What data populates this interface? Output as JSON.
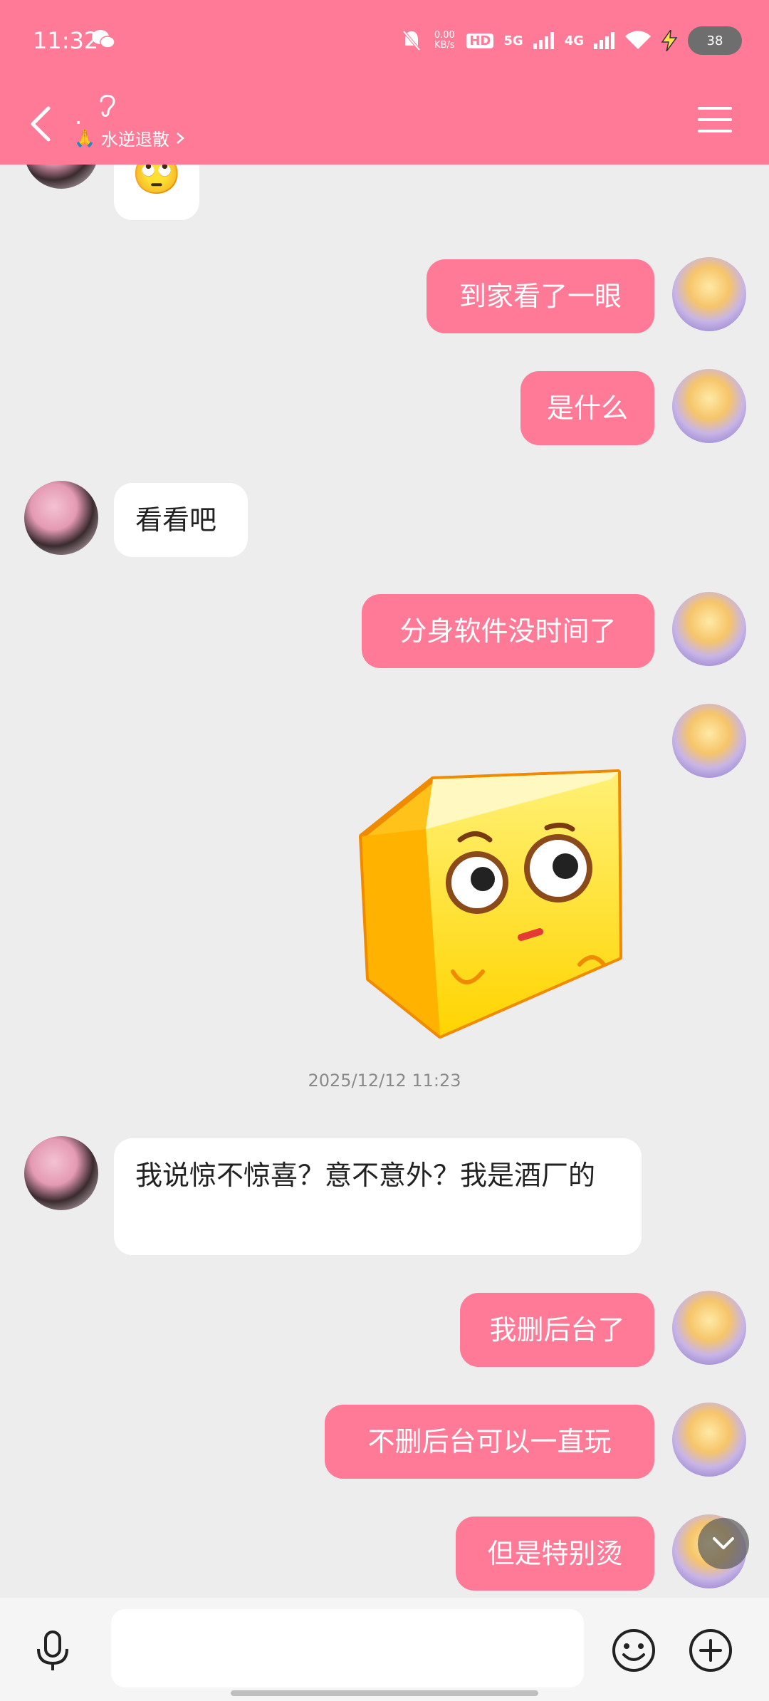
{
  "status_bar": {
    "time": "11:32",
    "net_speed_value": "0.00",
    "net_speed_unit": "KB/s",
    "hd_label": "HD",
    "sim1_label": "5G",
    "sim2_label": "4G",
    "battery_level": "38"
  },
  "header": {
    "title": ".",
    "subtitle": "水逆退散",
    "bg_color": "#FF7A96"
  },
  "messages": [
    {
      "side": "left",
      "type": "sticker",
      "label": "🙄"
    },
    {
      "side": "right",
      "type": "text",
      "text": "到家看了一眼"
    },
    {
      "side": "right",
      "type": "text",
      "text": "是什么"
    },
    {
      "side": "left",
      "type": "text",
      "text": "看看吧"
    },
    {
      "side": "right",
      "type": "text",
      "text": "分身软件没时间了"
    },
    {
      "side": "right",
      "type": "sticker",
      "label": "yellow-cube-sticker"
    },
    {
      "type": "timestamp",
      "text": "2025/12/12  11:23"
    },
    {
      "side": "left",
      "type": "text",
      "text": "我说惊不惊喜？意不意外？我是酒厂的"
    },
    {
      "side": "right",
      "type": "text",
      "text": "我删后台了"
    },
    {
      "side": "right",
      "type": "text",
      "text": "不删后台可以一直玩"
    },
    {
      "side": "right",
      "type": "text",
      "text": "但是特别烫"
    }
  ],
  "input": {
    "placeholder": "",
    "value": ""
  },
  "icons": {
    "back": "chevron-left-icon",
    "menu": "hamburger-menu-icon",
    "mic": "microphone-icon",
    "emoji": "emoji-icon",
    "plus": "plus-icon",
    "scroll_down": "chevron-down-icon"
  }
}
